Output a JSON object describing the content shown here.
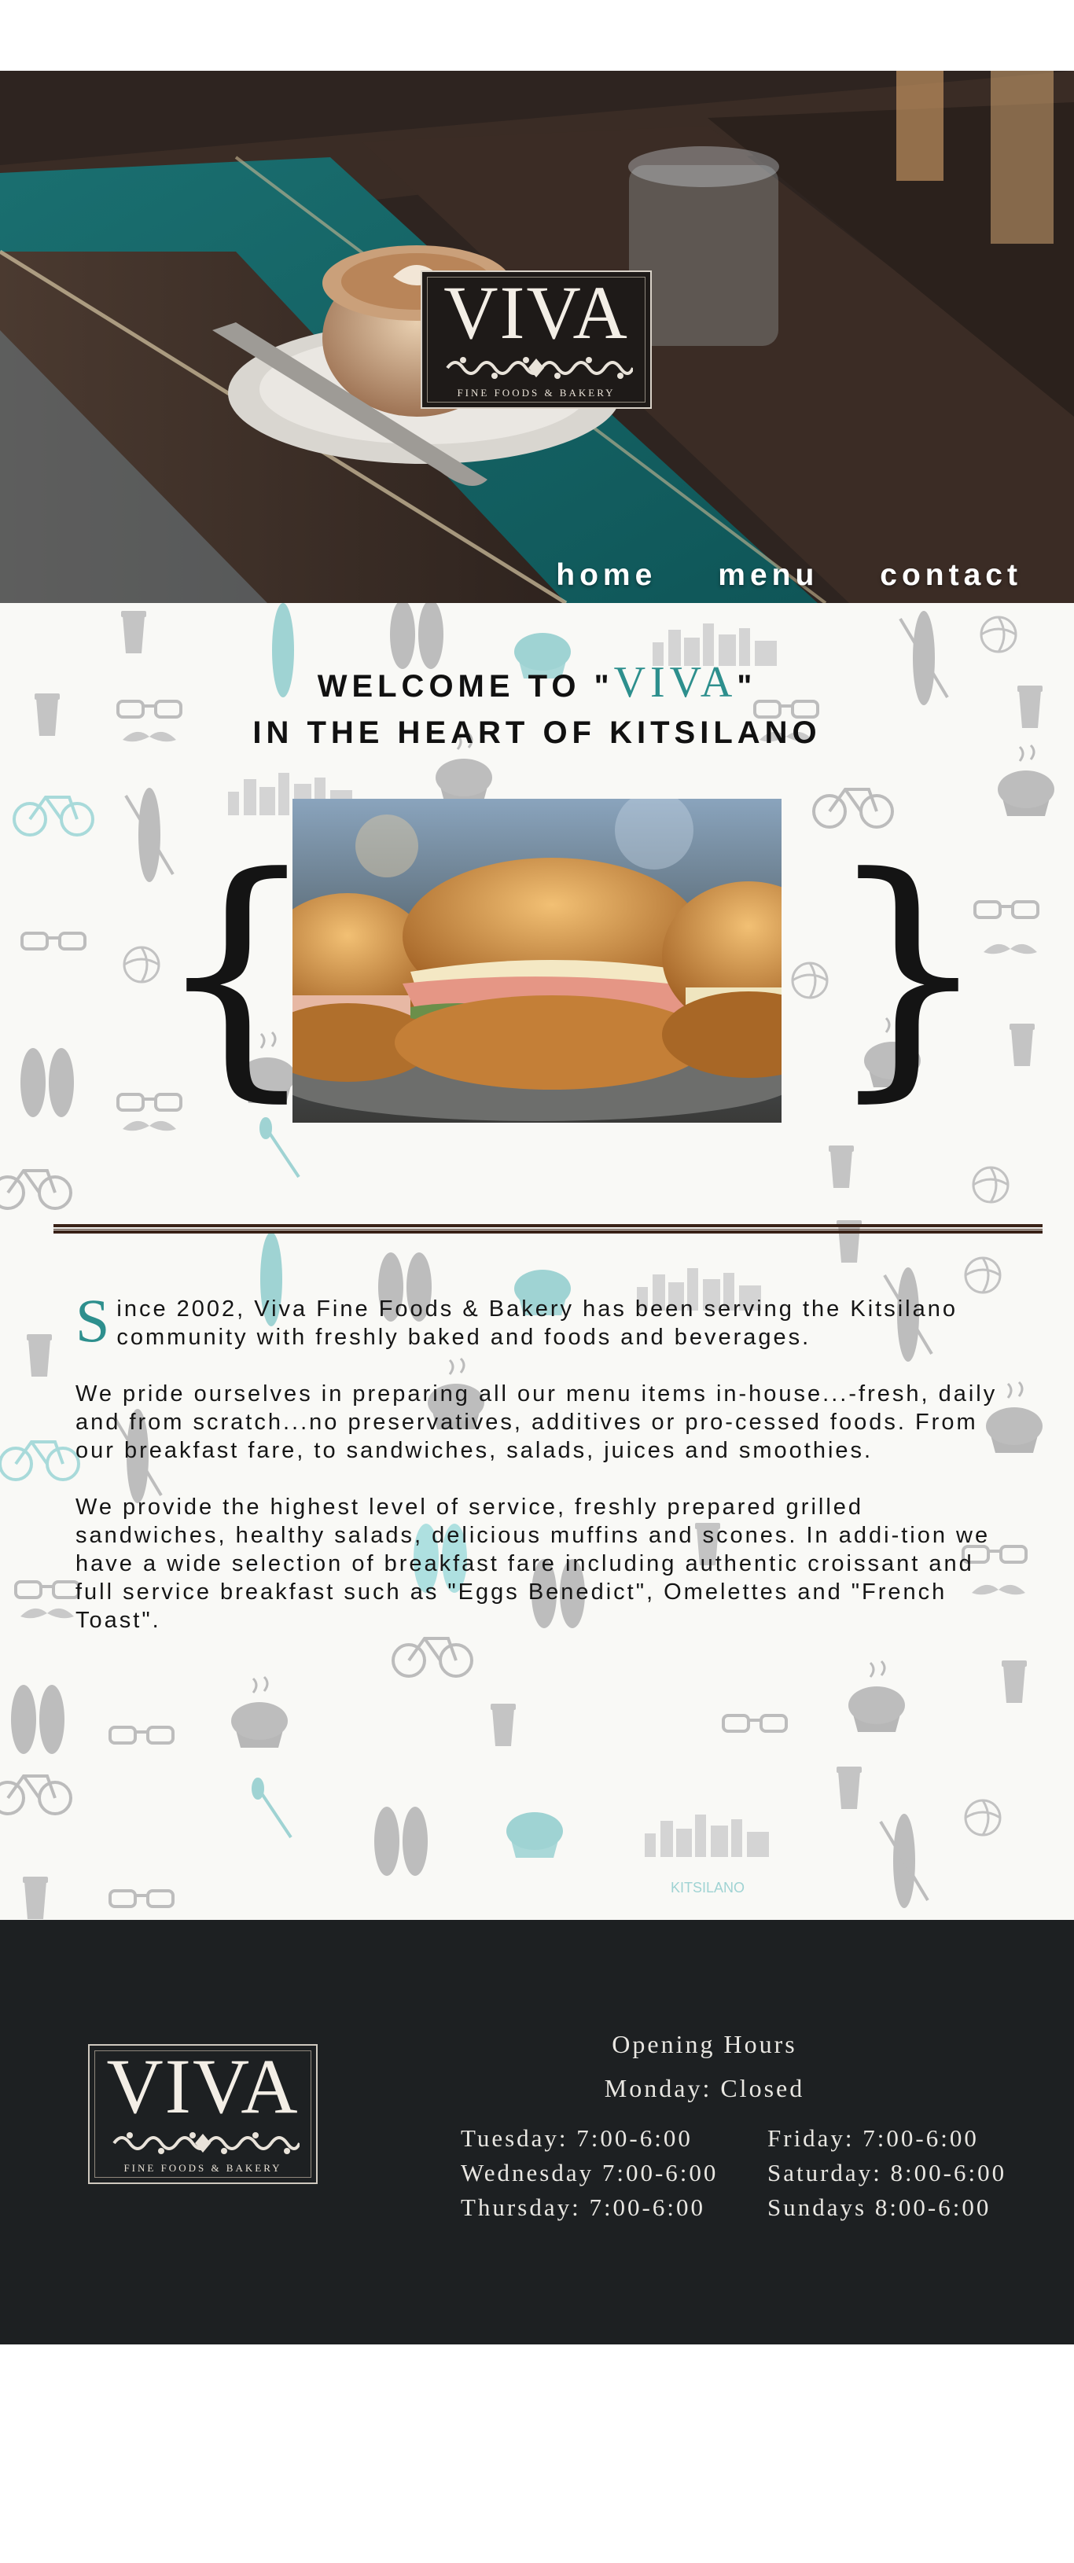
{
  "hero": {
    "logo": {
      "word": "VIVA",
      "tagline": "FINE FOODS & BAKERY"
    },
    "nav": [
      {
        "label": "home"
      },
      {
        "label": "menu"
      },
      {
        "label": "contact"
      }
    ]
  },
  "welcome": {
    "line1_prefix": "WELCOME TO \"",
    "brand": "VIVA",
    "line1_suffix": "\"",
    "line2": "IN THE HEART OF KITSILANO"
  },
  "pattern": {
    "kitsilano_label": "KITSILANO"
  },
  "about": {
    "dropcap": "S",
    "paragraphs": [
      "ince 2002, Viva Fine Foods & Bakery has been serving the Kitsilano community with freshly baked and foods and beverages.",
      "We pride ourselves in preparing all our menu items in-house...-fresh, daily and from scratch...no preservatives, additives or pro-cessed foods. From our breakfast fare, to sandwiches, salads, juices and smoothies.",
      "We provide the highest level of service, freshly prepared grilled sandwiches, healthy salads, delicious muffins and scones. In addi-tion we have a wide selection of breakfast fare including authentic croissant and full service breakfast such as \"Eggs Benedict\", Omelettes and \"French Toast\"."
    ]
  },
  "footer": {
    "logo": {
      "word": "VIVA",
      "tagline": "FINE FOODS & BAKERY"
    },
    "hours_title": "Opening Hours",
    "monday": "Monday: Closed",
    "left_column": [
      "Tuesday: 7:00-6:00",
      "Wednesday 7:00-6:00",
      "Thursday: 7:00-6:00"
    ],
    "right_column": [
      "Friday: 7:00-6:00",
      "Saturday: 8:00-6:00",
      "Sundays 8:00-6:00"
    ]
  },
  "colors": {
    "accent_teal": "#2d8f8d",
    "footer_bg": "#1d2022",
    "main_bg": "#f9f9f6",
    "divider": "#3a2318"
  }
}
